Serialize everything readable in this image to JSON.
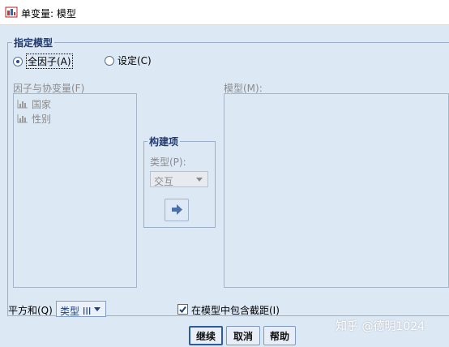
{
  "window": {
    "title": "单变量: 模型"
  },
  "model_group": {
    "legend": "指定模型",
    "radio_full_factorial": {
      "label": "全因子(A)",
      "checked": true
    },
    "radio_custom": {
      "label": "设定(C)",
      "checked": false
    }
  },
  "factors": {
    "label": "因子与协变量(F)",
    "items": [
      {
        "label": "国家",
        "icon": "scale-variable-icon"
      },
      {
        "label": "性别",
        "icon": "scale-variable-icon"
      }
    ]
  },
  "model_list": {
    "label": "模型(M):"
  },
  "build_terms": {
    "legend": "构建项",
    "type_label": "类型(P):",
    "type_value": "交互",
    "arrow_icon": "right-arrow-icon"
  },
  "sum_of_squares": {
    "label": "平方和(Q)",
    "value": "类型 III"
  },
  "include_intercept": {
    "label": "在模型中包含截距(I)",
    "checked": true
  },
  "buttons": {
    "continue": "继续",
    "cancel": "取消",
    "help": "帮助"
  },
  "watermark": "知乎 @德明1024",
  "colors": {
    "accent": "#1f3a73",
    "dialog_bg": "#dde8f5",
    "disabled_text": "#8b8b8b"
  }
}
